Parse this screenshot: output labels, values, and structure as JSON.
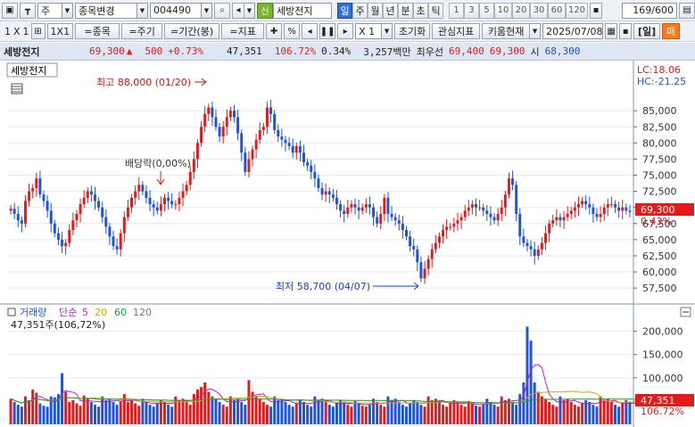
{
  "toolbar1": {
    "market": "주",
    "code_change": "종목변경",
    "code": "004490",
    "stock_name": "세방전지",
    "shin_badge": "신",
    "periods": [
      "일",
      "주",
      "월",
      "년",
      "분",
      "초",
      "틱"
    ],
    "active_period": "일",
    "intervals": [
      "1",
      "3",
      "5",
      "10",
      "20",
      "30",
      "60",
      "120"
    ],
    "count": "169",
    "count_total": "/600"
  },
  "toolbar2": {
    "layout1": "1",
    "layout_x": "X",
    "layout2": "1",
    "onex": "1X1",
    "item_btn": "=종목",
    "period_btn": "=주기",
    "range_btn": "=기간(봉)",
    "indicator_btn": "=지표",
    "percent": "%",
    "zoom": "X 1",
    "reset": "초기화",
    "interest": "관심지표",
    "kiwoom": "키움현재",
    "date": "2025/07/08",
    "unit": "[일]",
    "trade": "매"
  },
  "info": {
    "name": "세방전지",
    "price": "69,300",
    "change": "500",
    "change_pct": "+0.73%",
    "volume": "47,351",
    "vol_ratio": "106.72%",
    "turnover": "0.34%",
    "amount": "3,257백만",
    "best": "최우선",
    "ask": "69,400",
    "bid": "69,300",
    "open_label": "시",
    "open": "68,300"
  },
  "chart_data": {
    "type": "candlestick",
    "title": "세방전지",
    "price_axis": {
      "ticks": [
        85000,
        82500,
        80000,
        77500,
        75000,
        72500,
        70000,
        67500,
        65000,
        62500,
        60000,
        57500
      ],
      "tick_labels": [
        "85,000",
        "82,500",
        "80,000",
        "77,500",
        "75,000",
        "72,500",
        "70,000",
        "67,500",
        "65,000",
        "62,500",
        "60,000",
        "57,500"
      ],
      "ylim": [
        56000,
        90000
      ]
    },
    "current_price": "69,300",
    "current_pct": "0.43%",
    "lc": "LC:18.06",
    "hc": "HC:-21.25",
    "high_annotation": "최고 88,000 (01/20)",
    "low_annotation": "최저 58,700 (04/07)",
    "dividend_annotation": "배당락(0,00%)",
    "volume_legend": {
      "label": "거래량",
      "ma_label": "단순",
      "ma_periods": [
        "5",
        "20",
        "60",
        "120"
      ]
    },
    "volume_value": "47,351주(106,72%)",
    "volume_axis": {
      "ticks": [
        200000,
        150000,
        100000,
        50000
      ],
      "tick_labels": [
        "200,000",
        "150,000",
        "100,000",
        "50,000"
      ],
      "ylim": [
        0,
        230000
      ]
    },
    "current_volume": "47,351",
    "current_volume_pct": "106.72%",
    "closes": [
      69800,
      69000,
      68000,
      67500,
      71000,
      72500,
      73000,
      74500,
      72000,
      71000,
      69500,
      67500,
      66000,
      65000,
      64000,
      64500,
      66500,
      68000,
      69000,
      70500,
      71500,
      72500,
      72000,
      71000,
      70000,
      68500,
      67000,
      65500,
      64000,
      63500,
      66000,
      68500,
      70000,
      71500,
      72500,
      73500,
      72500,
      71500,
      70500,
      70000,
      69500,
      70500,
      71500,
      71000,
      70500,
      70500,
      71500,
      72500,
      73500,
      75500,
      77500,
      80000,
      82500,
      84500,
      85500,
      84000,
      82500,
      81000,
      82500,
      84000,
      85000,
      84000,
      81500,
      78500,
      75500,
      77500,
      79000,
      80500,
      82000,
      82500,
      85500,
      84500,
      82000,
      81000,
      80500,
      80000,
      79500,
      78500,
      79500,
      78500,
      77000,
      76500,
      75500,
      74500,
      73000,
      72000,
      72500,
      72000,
      71500,
      70500,
      69500,
      69000,
      70000,
      70500,
      70000,
      69500,
      70000,
      70500,
      70000,
      68500,
      67500,
      69000,
      71500,
      69000,
      68500,
      68000,
      67500,
      66500,
      65500,
      64000,
      63500,
      61500,
      59000,
      60500,
      62000,
      63500,
      64500,
      65500,
      66500,
      67000,
      67000,
      67500,
      68000,
      68500,
      69500,
      70000,
      70500,
      70000,
      70000,
      69500,
      69000,
      68500,
      68000,
      69000,
      70000,
      72000,
      74500,
      73500,
      69000,
      65500,
      64500,
      64000,
      63500,
      62500,
      63500,
      64500,
      66000,
      67500,
      68000,
      68500,
      68000,
      68500,
      69000,
      69500,
      70000,
      70500,
      71000,
      70500,
      70000,
      69000,
      68500,
      69000,
      70000,
      70500,
      70500,
      70000,
      69500,
      70000,
      69500,
      69300
    ],
    "volumes": [
      55000,
      48000,
      42000,
      38000,
      60000,
      52000,
      75000,
      68000,
      45000,
      40000,
      38000,
      60000,
      58000,
      65000,
      110000,
      70000,
      48000,
      52000,
      45000,
      40000,
      62000,
      55000,
      48000,
      42000,
      38000,
      60000,
      52000,
      55000,
      48000,
      42000,
      50000,
      65000,
      48000,
      52000,
      45000,
      40000,
      55000,
      48000,
      42000,
      38000,
      45000,
      52000,
      48000,
      42000,
      38000,
      60000,
      52000,
      55000,
      48000,
      42000,
      65000,
      75000,
      80000,
      90000,
      70000,
      60000,
      55000,
      48000,
      42000,
      38000,
      60000,
      52000,
      55000,
      48000,
      42000,
      95000,
      70000,
      60000,
      55000,
      48000,
      42000,
      38000,
      60000,
      52000,
      55000,
      48000,
      42000,
      38000,
      45000,
      52000,
      48000,
      42000,
      38000,
      60000,
      52000,
      55000,
      48000,
      42000,
      38000,
      45000,
      52000,
      48000,
      42000,
      38000,
      50000,
      45000,
      40000,
      38000,
      42000,
      55000,
      48000,
      42000,
      38000,
      60000,
      52000,
      55000,
      48000,
      42000,
      38000,
      45000,
      52000,
      48000,
      42000,
      38000,
      60000,
      52000,
      55000,
      48000,
      42000,
      38000,
      45000,
      52000,
      48000,
      42000,
      38000,
      50000,
      45000,
      40000,
      38000,
      42000,
      55000,
      48000,
      42000,
      38000,
      60000,
      52000,
      55000,
      48000,
      42000,
      65000,
      90000,
      210000,
      180000,
      90000,
      70000,
      60000,
      55000,
      48000,
      42000,
      38000,
      60000,
      52000,
      55000,
      48000,
      42000,
      38000,
      45000,
      52000,
      48000,
      42000,
      38000,
      60000,
      52000,
      55000,
      48000,
      42000,
      38000,
      45000,
      52000,
      48000,
      42000,
      38000,
      47351
    ]
  }
}
